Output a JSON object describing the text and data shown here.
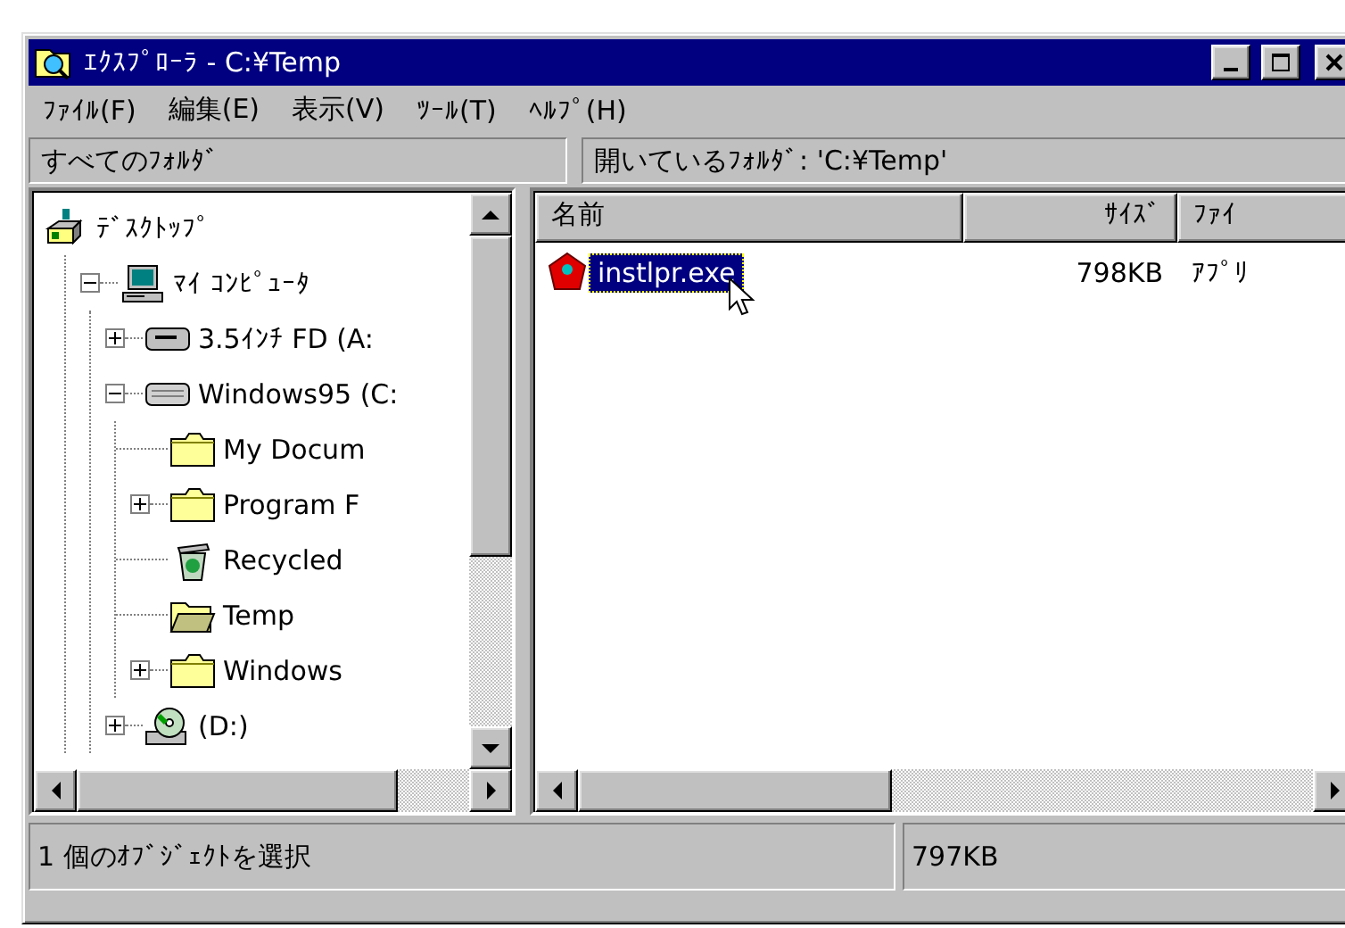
{
  "window": {
    "title": "ｴｸｽﾌﾟﾛｰﾗ - C:¥Temp"
  },
  "menu": [
    "ﾌｧｲﾙ(F)",
    "編集(E)",
    "表示(V)",
    "ﾂｰﾙ(T)",
    "ﾍﾙﾌﾟ(H)"
  ],
  "left_header": "すべてのﾌｫﾙﾀﾞ",
  "right_header": "開いているﾌｫﾙﾀﾞ: 'C:¥Temp'",
  "tree": [
    {
      "label": "ﾃﾞｽｸﾄｯﾌﾟ",
      "kind": "desktop",
      "children": [
        {
          "label": "ﾏｲ ｺﾝﾋﾟｭｰﾀ",
          "kind": "computer",
          "expanded": true,
          "children": [
            {
              "label": "3.5ｲﾝﾁ FD (A:",
              "kind": "floppy",
              "expanded": false
            },
            {
              "label": "Windows95 (C:",
              "kind": "harddisk",
              "expanded": true,
              "children": [
                {
                  "label": "My Docum",
                  "kind": "folder"
                },
                {
                  "label": "Program F",
                  "kind": "folder",
                  "expanded": false
                },
                {
                  "label": "Recycled",
                  "kind": "recycle"
                },
                {
                  "label": "Temp",
                  "kind": "openfolder"
                },
                {
                  "label": "Windows",
                  "kind": "folder",
                  "expanded": false
                }
              ]
            },
            {
              "label": "(D:)",
              "kind": "cdrom",
              "expanded": false
            }
          ]
        }
      ]
    }
  ],
  "list": {
    "columns": [
      "名前",
      "ｻｲｽﾞ",
      "ﾌｧｲ"
    ],
    "rows": [
      {
        "name": "instlpr.exe",
        "size": "798KB",
        "type": "ｱﾌﾟﾘ",
        "selected": true
      }
    ]
  },
  "status_bar": [
    "1 個のｵﾌﾞｼﾞｪｸﾄを選択",
    "797KB"
  ]
}
